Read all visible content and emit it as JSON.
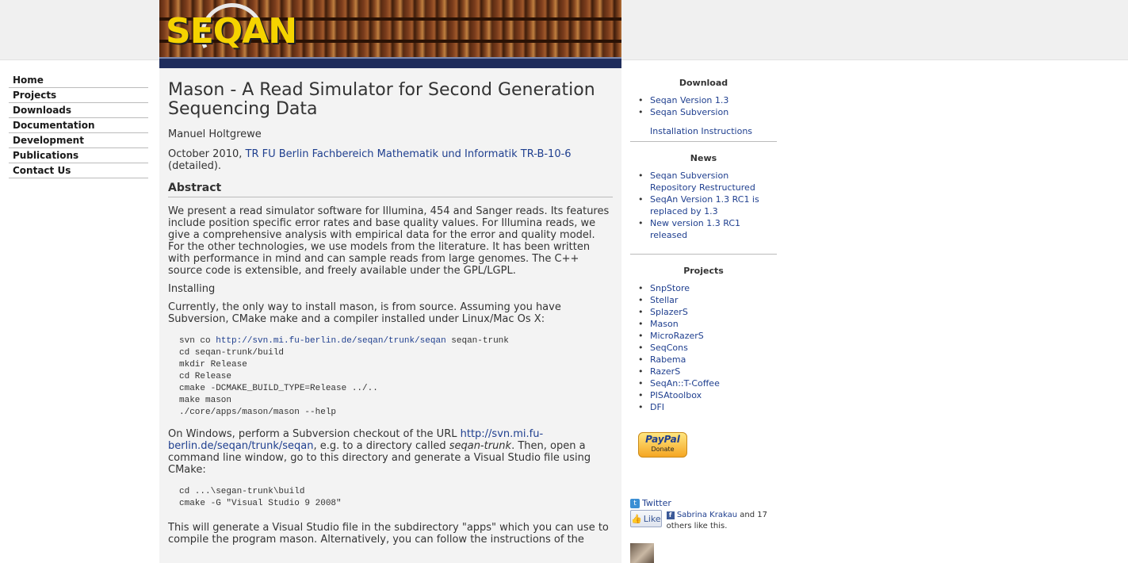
{
  "banner": {
    "logo_text": "SEQAN"
  },
  "nav": [
    {
      "label": "Home"
    },
    {
      "label": "Projects"
    },
    {
      "label": "Downloads"
    },
    {
      "label": "Documentation"
    },
    {
      "label": "Development"
    },
    {
      "label": "Publications"
    },
    {
      "label": "Contact Us"
    }
  ],
  "main": {
    "title": "Mason - A Read Simulator for Second Generation Sequencing Data",
    "author": "Manuel Holtgrewe",
    "date_prefix": "October 2010, ",
    "date_link": "TR FU Berlin Fachbereich Mathematik und Informatik TR-B-10-6",
    "date_suffix": " (detailed).",
    "abstract_heading": "Abstract",
    "abstract_text": "We present a read simulator software for Illumina, 454 and Sanger reads. Its features include position specific error rates and base quality values. For Illumina reads, we give a comprehensive analysis with empirical data for the error and quality model. For the other technologies, we use models from the literature. It has been written with performance in mind and can sample reads from large genomes. The C++ source code is extensible, and freely available under the GPL/LGPL.",
    "installing_heading": "Installing",
    "install_text": "Currently, the only way to install mason, is from source. Assuming you have Subversion, CMake make and a compiler installed under Linux/Mac Os X:",
    "code1_prefix": "svn co ",
    "code1_link": "http://svn.mi.fu-berlin.de/seqan/trunk/seqan",
    "code1_suffix": " seqan-trunk",
    "code1_rest": "cd seqan-trunk/build\nmkdir Release\ncd Release\ncmake -DCMAKE_BUILD_TYPE=Release ../..\nmake mason\n./core/apps/mason/mason --help",
    "win_prefix": "On Windows, perform a Subversion checkout of the URL ",
    "win_link": "http://svn.mi.fu-berlin.de/seqan/trunk/seqan",
    "win_mid": ", e.g. to a directory called ",
    "win_em": "seqan-trunk",
    "win_suffix": ". Then, open a command line window, go to this directory and generate a Visual Studio file using CMake:",
    "code2": "cd ...\\segan-trunk\\build\ncmake -G \"Visual Studio 9 2008\"",
    "final_text": "This will generate a Visual Studio file in the subdirectory \"apps\" which you can use to compile the program mason. Alternatively, you can follow the instructions of the"
  },
  "sidebar": {
    "download_heading": "Download",
    "download_links": [
      "Seqan Version 1.3",
      "Seqan Subversion"
    ],
    "install_link": "Installation Instructions",
    "news_heading": "News",
    "news_links": [
      "Seqan Subversion Repository Restructured",
      "SeqAn Version 1.3 RC1 is replaced by 1.3",
      "New version 1.3 RC1 released"
    ],
    "projects_heading": "Projects",
    "project_links": [
      "SnpStore",
      "Stellar",
      "SplazerS",
      "Mason",
      "MicroRazerS",
      "SeqCons",
      "Rabema",
      "RazerS",
      "SeqAn::T-Coffee",
      "PISAtoolbox",
      "DFI"
    ],
    "paypal_brand": "PayPal",
    "paypal_action": "Donate"
  },
  "social": {
    "twitter_label": "Twitter",
    "like_label": "Like",
    "fb_name": "Sabrina Krakau",
    "fb_suffix": " and 17 others like this."
  }
}
